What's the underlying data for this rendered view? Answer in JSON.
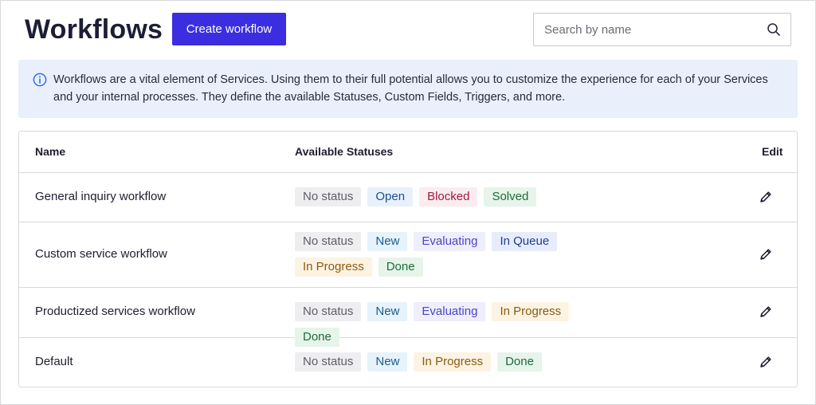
{
  "header": {
    "title": "Workflows",
    "create_button": "Create workflow",
    "search_placeholder": "Search by name"
  },
  "banner": {
    "text": "Workflows are a vital element of Services. Using them to their full potential allows you to customize the experience for each of your Services and your internal processes. They define the available Statuses, Custom Fields, Triggers, and more."
  },
  "table": {
    "columns": {
      "name": "Name",
      "statuses": "Available Statuses",
      "edit": "Edit"
    },
    "rows": [
      {
        "name": "General inquiry workflow",
        "statuses": [
          "No status",
          "Open",
          "Blocked",
          "Solved"
        ]
      },
      {
        "name": "Custom service workflow",
        "statuses": [
          "No status",
          "New",
          "Evaluating",
          "In Queue",
          "In Progress",
          "Done"
        ]
      },
      {
        "name": "Productized services workflow",
        "statuses": [
          "No status",
          "New",
          "Evaluating",
          "In Progress",
          "Done"
        ]
      },
      {
        "name": "Default",
        "statuses": [
          "No status",
          "New",
          "In Progress",
          "Done"
        ]
      }
    ]
  },
  "status_colors": {
    "No status": {
      "bg": "#eeeef0",
      "fg": "#5e5e68"
    },
    "Open": {
      "bg": "#e6f1fb",
      "fg": "#1f4f8f"
    },
    "Blocked": {
      "bg": "#fbecef",
      "fg": "#a3193f"
    },
    "Solved": {
      "bg": "#e6f4ea",
      "fg": "#1e6b38"
    },
    "New": {
      "bg": "#e6f3fb",
      "fg": "#1f5a8f"
    },
    "Evaluating": {
      "bg": "#eeeefc",
      "fg": "#4b45c9"
    },
    "In Queue": {
      "bg": "#e6ecfb",
      "fg": "#1f3f8f"
    },
    "In Progress": {
      "bg": "#fdf3e3",
      "fg": "#8a5a12"
    },
    "Done": {
      "bg": "#e6f4ea",
      "fg": "#1e6b38"
    }
  },
  "icons": {
    "search": "search-icon",
    "info": "info-icon",
    "edit": "pencil-icon"
  },
  "colors": {
    "accent": "#3b2ee0",
    "banner_bg": "#e9f0fc"
  }
}
